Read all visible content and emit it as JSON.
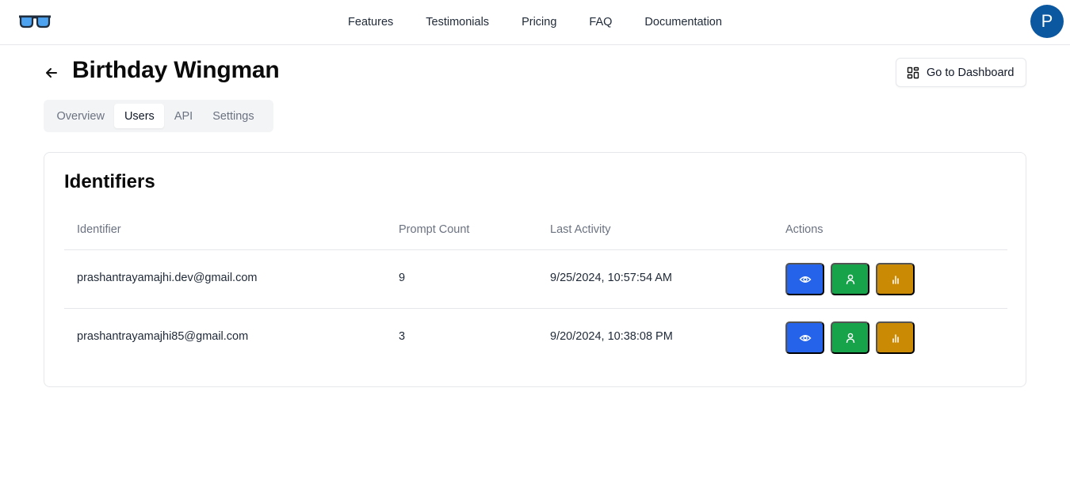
{
  "header": {
    "logo_icon": "sunglasses-icon",
    "nav": [
      {
        "label": "Features"
      },
      {
        "label": "Testimonials"
      },
      {
        "label": "Pricing"
      },
      {
        "label": "FAQ"
      },
      {
        "label": "Documentation"
      }
    ],
    "avatar_initial": "P",
    "avatar_color": "#0b57a0"
  },
  "page": {
    "back_icon": "arrow-left-icon",
    "title": "Birthday Wingman",
    "dashboard_button": {
      "icon": "layout-grid-icon",
      "label": "Go to Dashboard"
    },
    "tabs": [
      {
        "label": "Overview",
        "active": false
      },
      {
        "label": "Users",
        "active": true
      },
      {
        "label": "API",
        "active": false
      },
      {
        "label": "Settings",
        "active": false
      }
    ]
  },
  "identifiers": {
    "title": "Identifiers",
    "columns": [
      "Identifier",
      "Prompt Count",
      "Last Activity",
      "Actions"
    ],
    "rows": [
      {
        "identifier": "prashantrayamajhi.dev@gmail.com",
        "prompt_count": "9",
        "last_activity": "9/25/2024, 10:57:54 AM"
      },
      {
        "identifier": "prashantrayamajhi85@gmail.com",
        "prompt_count": "3",
        "last_activity": "9/20/2024, 10:38:08 PM"
      }
    ],
    "actions": [
      {
        "name": "view",
        "icon": "eye-icon",
        "color": "#2563eb"
      },
      {
        "name": "user",
        "icon": "user-icon",
        "color": "#16a34a"
      },
      {
        "name": "stats",
        "icon": "bar-chart-icon",
        "color": "#ca8a04"
      }
    ]
  }
}
